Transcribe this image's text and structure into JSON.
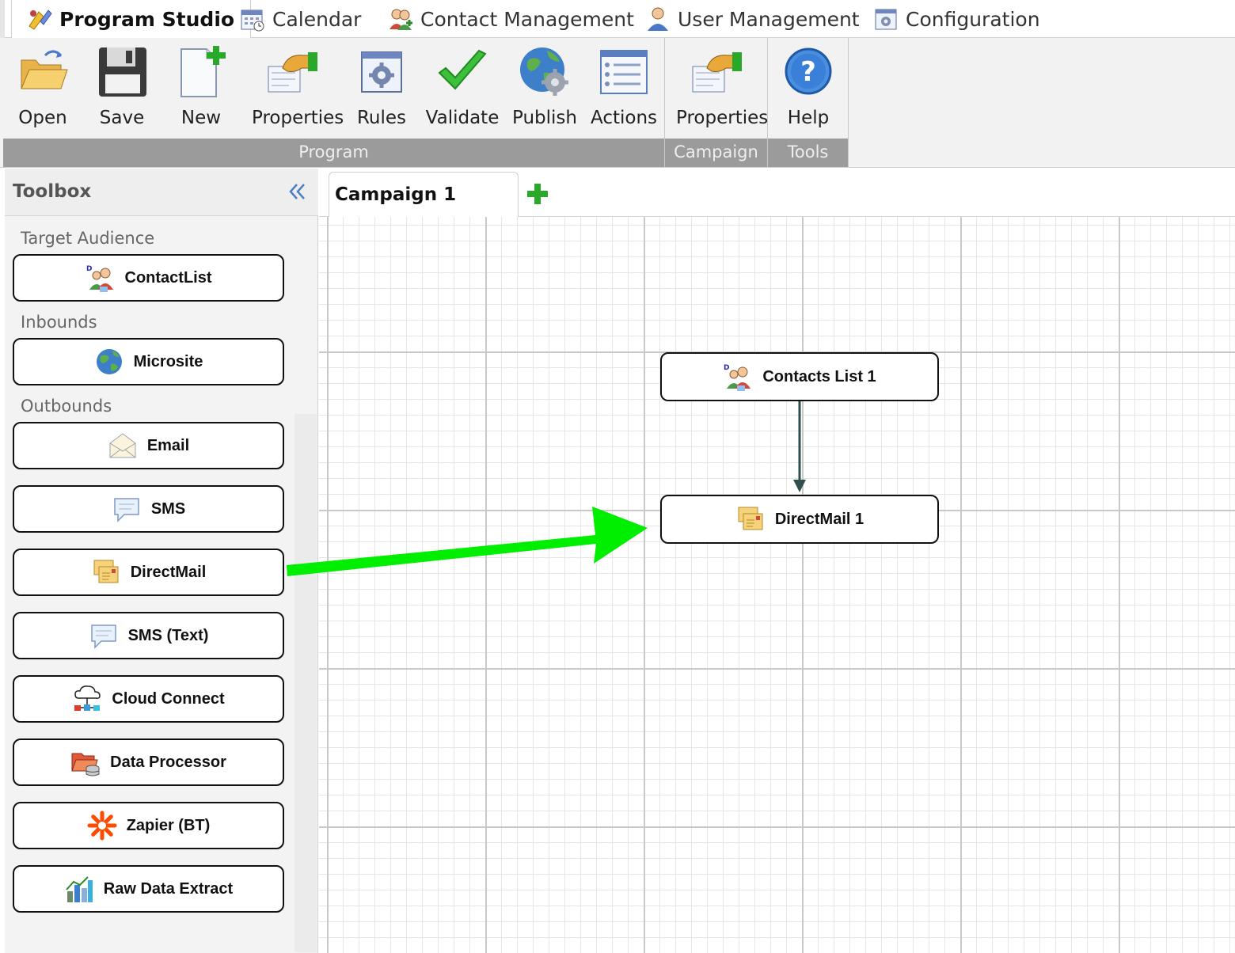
{
  "top_tabs": [
    {
      "label": "Program Studio",
      "icon": "program-studio-icon",
      "active": true
    },
    {
      "label": "Calendar",
      "icon": "calendar-icon"
    },
    {
      "label": "Contact Management",
      "icon": "contacts-icon"
    },
    {
      "label": "User Management",
      "icon": "user-icon"
    },
    {
      "label": "Configuration",
      "icon": "configuration-icon"
    }
  ],
  "ribbon": {
    "groups": [
      {
        "label": "Program",
        "buttons": [
          "Open",
          "Save",
          "New",
          "Properties",
          "Rules",
          "Validate",
          "Publish",
          "Actions"
        ]
      },
      {
        "label": "Campaign",
        "buttons": [
          "Properties"
        ]
      },
      {
        "label": "Tools",
        "buttons": [
          "Help"
        ]
      }
    ]
  },
  "toolbox": {
    "title": "Toolbox",
    "sections": [
      {
        "label": "Target Audience",
        "items": [
          "ContactList"
        ]
      },
      {
        "label": "Inbounds",
        "items": [
          "Microsite"
        ]
      },
      {
        "label": "Outbounds",
        "items": [
          "Email",
          "SMS",
          "DirectMail",
          "SMS (Text)",
          "Cloud Connect",
          "Data Processor",
          "Zapier (BT)",
          "Raw Data Extract"
        ]
      }
    ]
  },
  "canvas": {
    "tab_label": "Campaign 1",
    "nodes": [
      "Contacts List 1",
      "DirectMail 1"
    ]
  },
  "colors": {
    "annotation_arrow": "#00ee00",
    "ribbon_group_label_bg": "#9b9b9b",
    "connector": "#2f4f4f"
  }
}
